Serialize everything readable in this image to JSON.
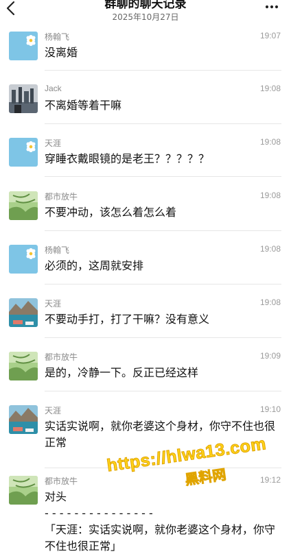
{
  "header": {
    "title": "群聊的聊天记录",
    "date": "2025年10月27日"
  },
  "messages": [
    {
      "name": "杨翰飞",
      "time": "19:07",
      "content": "没离婚",
      "avatar": "daisy"
    },
    {
      "name": "Jack",
      "time": "19:08",
      "content": "不离婚等着干嘛",
      "avatar": "city"
    },
    {
      "name": "天涯",
      "time": "19:08",
      "content": "穿睡衣戴眼镜的是老王？？？？？",
      "avatar": "daisy"
    },
    {
      "name": "都市放牛",
      "time": "19:08",
      "content": "不要冲动，该怎么着怎么着",
      "avatar": "palm"
    },
    {
      "name": "杨翰飞",
      "time": "19:08",
      "content": "必须的，这周就安排",
      "avatar": "daisy"
    },
    {
      "name": "天涯",
      "time": "19:08",
      "content": "不要动手打，打了干嘛？没有意义",
      "avatar": "lake"
    },
    {
      "name": "都市放牛",
      "time": "19:09",
      "content": "是的，冷静一下。反正已经这样",
      "avatar": "palm"
    },
    {
      "name": "天涯",
      "time": "19:10",
      "content": "实话实说啊，就你老婆这个身材，你守不住也很正常",
      "avatar": "lake"
    },
    {
      "name": "都市放牛",
      "time": "19:12",
      "content": "对头\n- - - - - - - - - - - - - - -\n「天涯：实话实说啊，就你老婆这个身材，你守不住也很正常」",
      "avatar": "palm"
    }
  ],
  "watermark": {
    "url": "https://hlwa13.com",
    "name": "黑料网"
  },
  "colors": {
    "daisy_bg": "#7ec5e6",
    "palm_bg": "#8fbf6e",
    "lake_bg": "#3f8fb0",
    "watermark": "#ffd31a"
  }
}
